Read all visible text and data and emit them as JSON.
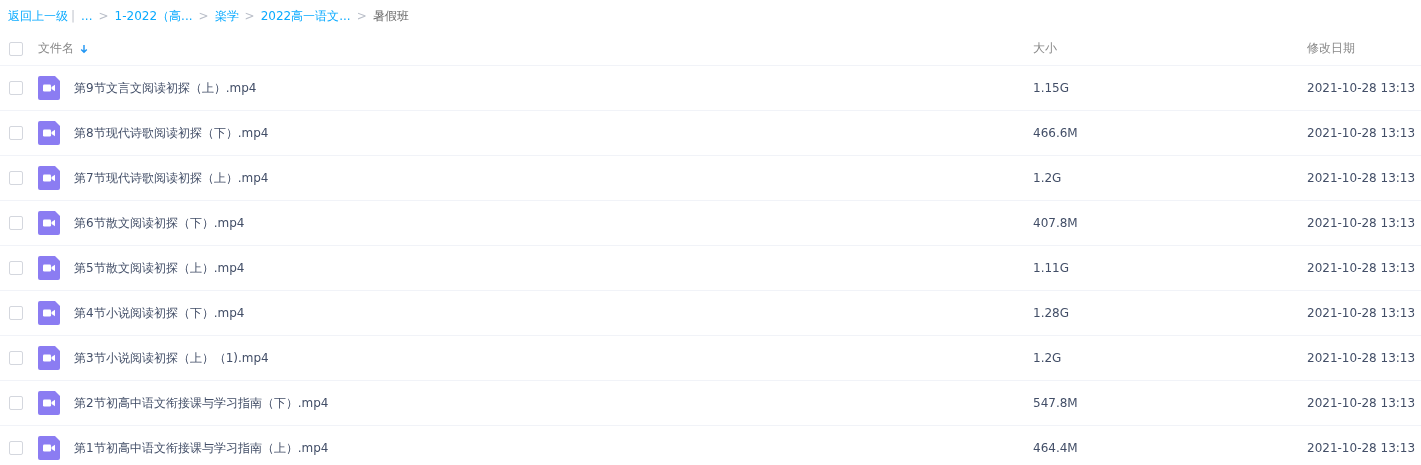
{
  "breadcrumb": {
    "back": "返回上一级",
    "divider": "|",
    "items": [
      {
        "label": "...",
        "current": false
      },
      {
        "separator": ">",
        "label": "1-2022（高...",
        "current": false
      },
      {
        "separator": ">",
        "label": "楽学",
        "current": false
      },
      {
        "separator": ">",
        "label": "2022高一语文...",
        "current": false
      },
      {
        "separator": ">",
        "label": "暑假班",
        "current": true
      }
    ]
  },
  "table": {
    "select_all": {
      "checked": false
    },
    "columns": [
      {
        "label": "文件名",
        "sorted": true
      },
      {
        "label": "大小"
      },
      {
        "label": "修改日期"
      }
    ],
    "rows": [
      {
        "checked": false,
        "kind": "video",
        "name": "第9节文言文阅读初探（上）.mp4",
        "size": "1.15G",
        "modified": "2021-10-28 13:13"
      },
      {
        "checked": false,
        "kind": "video",
        "name": "第8节现代诗歌阅读初探（下）.mp4",
        "size": "466.6M",
        "modified": "2021-10-28 13:13"
      },
      {
        "checked": false,
        "kind": "video",
        "name": "第7节现代诗歌阅读初探（上）.mp4",
        "size": "1.2G",
        "modified": "2021-10-28 13:13"
      },
      {
        "checked": false,
        "kind": "video",
        "name": "第6节散文阅读初探（下）.mp4",
        "size": "407.8M",
        "modified": "2021-10-28 13:13"
      },
      {
        "checked": false,
        "kind": "video",
        "name": "第5节散文阅读初探（上）.mp4",
        "size": "1.11G",
        "modified": "2021-10-28 13:13"
      },
      {
        "checked": false,
        "kind": "video",
        "name": "第4节小说阅读初探（下）.mp4",
        "size": "1.28G",
        "modified": "2021-10-28 13:13"
      },
      {
        "checked": false,
        "kind": "video",
        "name": "第3节小说阅读初探（上）（1).mp4",
        "size": "1.2G",
        "modified": "2021-10-28 13:13"
      },
      {
        "checked": false,
        "kind": "video",
        "name": "第2节初高中语文衔接课与学习指南（下）.mp4",
        "size": "547.8M",
        "modified": "2021-10-28 13:13"
      },
      {
        "checked": false,
        "kind": "video",
        "name": "第1节初高中语文衔接课与学习指南（上）.mp4",
        "size": "464.4M",
        "modified": "2021-10-28 13:13"
      }
    ]
  }
}
